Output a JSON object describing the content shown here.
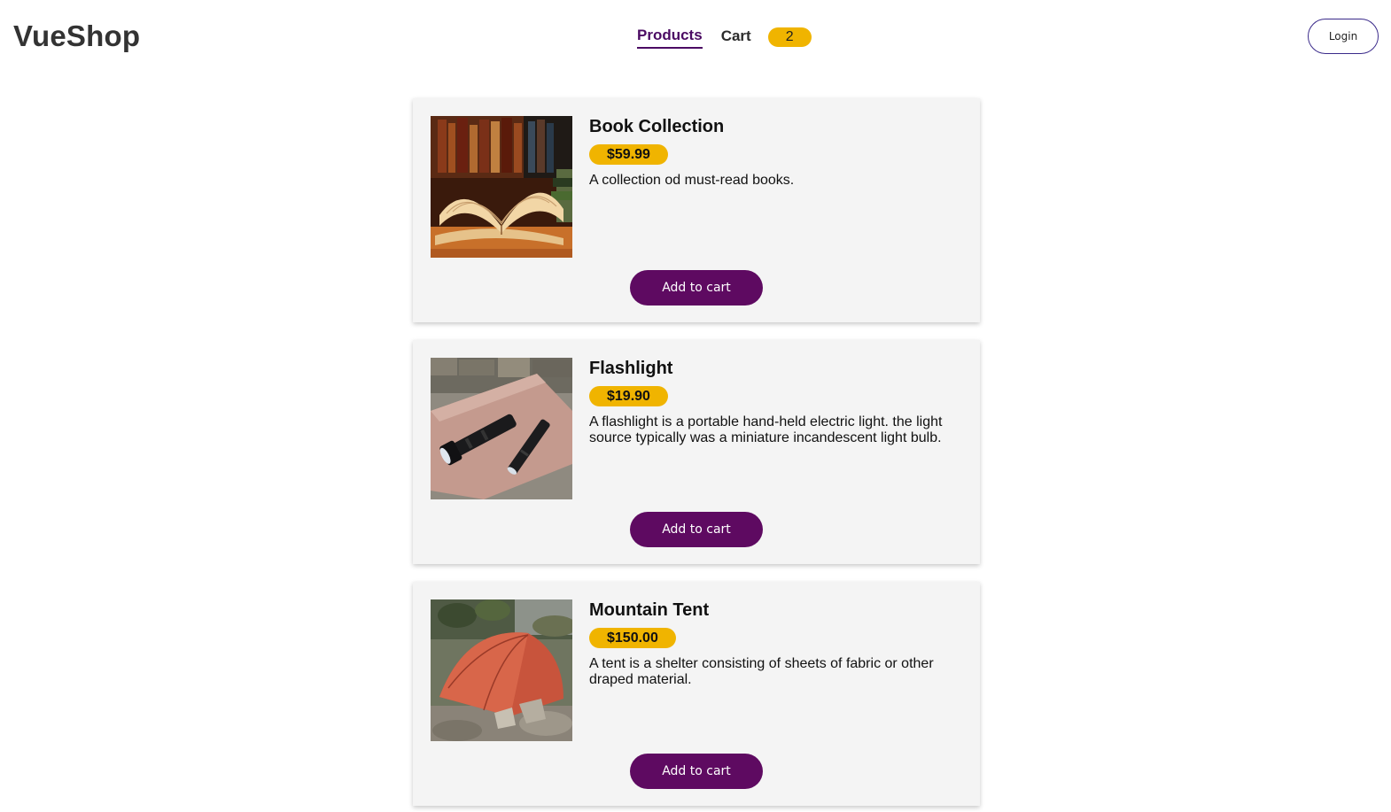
{
  "header": {
    "brand": "VueShop",
    "nav": {
      "products": "Products",
      "cart": "Cart",
      "cart_count": "2"
    },
    "login_label": "Login"
  },
  "products": [
    {
      "title": "Book Collection",
      "price": "$59.99",
      "description": "A collection od must-read books.",
      "button": "Add to cart"
    },
    {
      "title": "Flashlight",
      "price": "$19.90",
      "description": "A flashlight is a portable hand-held electric light. the light source typically was a miniature incandescent light bulb.",
      "button": "Add to cart"
    },
    {
      "title": "Mountain Tent",
      "price": "$150.00",
      "description": "A tent is a shelter consisting of sheets of fabric or other draped material.",
      "button": "Add to cart"
    }
  ],
  "colors": {
    "accent": "#5e0a61",
    "badge": "#f0b400",
    "card_bg": "#f4f4f4",
    "active_nav": "#4b0b63"
  }
}
